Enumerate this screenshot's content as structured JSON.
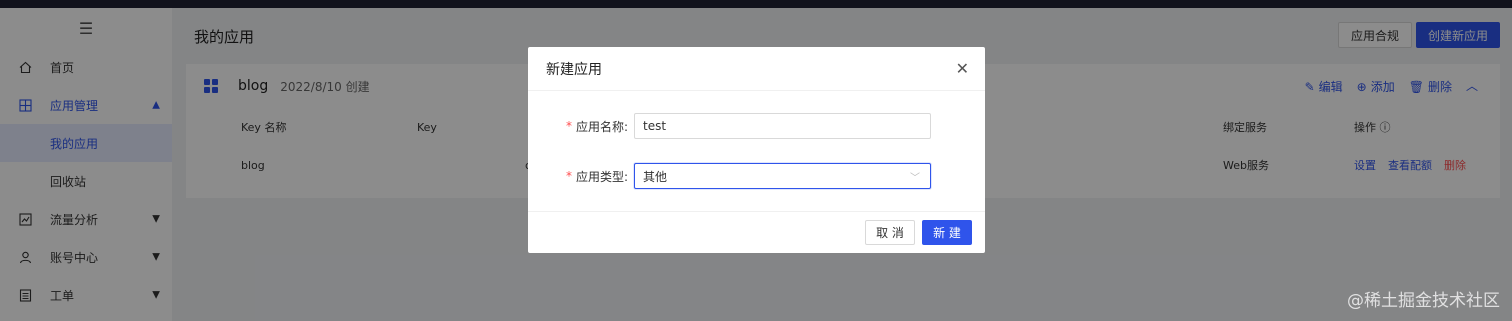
{
  "sidebar": {
    "toggle_icon": "☰",
    "items": [
      {
        "label": "首页",
        "icon": "home-icon"
      },
      {
        "label": "应用管理",
        "icon": "apps-icon"
      },
      {
        "label": "流量分析",
        "icon": "chart-icon"
      },
      {
        "label": "账号中心",
        "icon": "user-icon"
      },
      {
        "label": "工单",
        "icon": "ticket-icon"
      }
    ],
    "sub_items": [
      {
        "label": "我的应用"
      },
      {
        "label": "回收站"
      }
    ]
  },
  "main": {
    "title": "我的应用",
    "compliance_label": "应用合规",
    "create_label": "创建新应用",
    "card": {
      "name": "blog",
      "date": "2022/8/10 创建",
      "edit_label": "编辑",
      "add_label": "添加",
      "delete_label": "删除",
      "columns": [
        "Key 名称",
        "Key",
        "绑定服务",
        "操作"
      ],
      "rows": [
        {
          "key_name": "blog",
          "key_fragment": "c",
          "service": "Web服务",
          "actions": [
            "设置",
            "查看配额",
            "删除"
          ]
        }
      ]
    }
  },
  "modal": {
    "title": "新建应用",
    "name_label": "应用名称:",
    "name_value": "test",
    "type_label": "应用类型:",
    "type_value": "其他",
    "cancel_label": "取 消",
    "ok_label": "新 建"
  },
  "watermark": "@稀土掘金技术社区",
  "colors": {
    "accent": "#2f54eb",
    "danger": "#ff4d4f"
  }
}
